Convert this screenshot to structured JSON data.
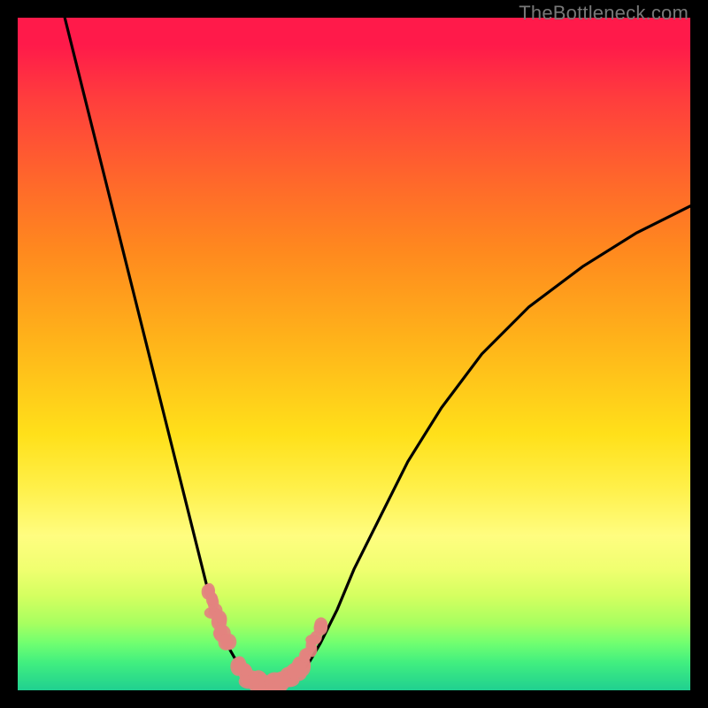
{
  "watermark": "TheBottleneck.com",
  "colors": {
    "curve": "#000000",
    "marker": "#e3837f",
    "gradient_top": "#ff1a4a",
    "gradient_bottom": "#20d090"
  },
  "chart_data": {
    "type": "line",
    "title": "",
    "xlabel": "",
    "ylabel": "",
    "xlim": [
      0,
      100
    ],
    "ylim": [
      0,
      100
    ],
    "grid": false,
    "legend": false,
    "description": "Bottleneck curve: single black line descending steeply from near top-left, reaching a rounded minimum near the bottom around one-third across, then rising more gradually to about one-third height at the right edge. Pink blob markers cluster at the minimum.",
    "curve_points_xy": [
      [
        7,
        100
      ],
      [
        9,
        92
      ],
      [
        11,
        84
      ],
      [
        13,
        76
      ],
      [
        15,
        68
      ],
      [
        17,
        60
      ],
      [
        19,
        52
      ],
      [
        21,
        44
      ],
      [
        23,
        36
      ],
      [
        25,
        28
      ],
      [
        26.5,
        22
      ],
      [
        28,
        16
      ],
      [
        29.5,
        11
      ],
      [
        31,
        7
      ],
      [
        33,
        3.5
      ],
      [
        35,
        1.5
      ],
      [
        37,
        0.8
      ],
      [
        39,
        0.8
      ],
      [
        41,
        1.6
      ],
      [
        43,
        3.6
      ],
      [
        45,
        7
      ],
      [
        47.5,
        12
      ],
      [
        50,
        18
      ],
      [
        54,
        26
      ],
      [
        58,
        34
      ],
      [
        63,
        42
      ],
      [
        69,
        50
      ],
      [
        76,
        57
      ],
      [
        84,
        63
      ],
      [
        92,
        68
      ],
      [
        100,
        72
      ]
    ],
    "marker_clusters": {
      "left_arm": [
        [
          28.5,
          14.5
        ],
        [
          28.9,
          13.2
        ],
        [
          29.4,
          11.8
        ],
        [
          29.9,
          10.4
        ],
        [
          30.5,
          8.8
        ],
        [
          31.2,
          7.2
        ]
      ],
      "bottom": [
        [
          33.0,
          3.4
        ],
        [
          33.9,
          2.3
        ],
        [
          34.8,
          1.6
        ],
        [
          35.7,
          1.2
        ],
        [
          36.6,
          0.95
        ],
        [
          37.5,
          0.85
        ],
        [
          38.4,
          0.95
        ],
        [
          39.3,
          1.25
        ],
        [
          40.2,
          1.8
        ],
        [
          41.1,
          2.6
        ],
        [
          42.0,
          3.6
        ]
      ],
      "right_arm": [
        [
          42.9,
          5.0
        ],
        [
          43.6,
          6.3
        ],
        [
          44.3,
          7.8
        ],
        [
          45.0,
          9.5
        ]
      ]
    }
  }
}
